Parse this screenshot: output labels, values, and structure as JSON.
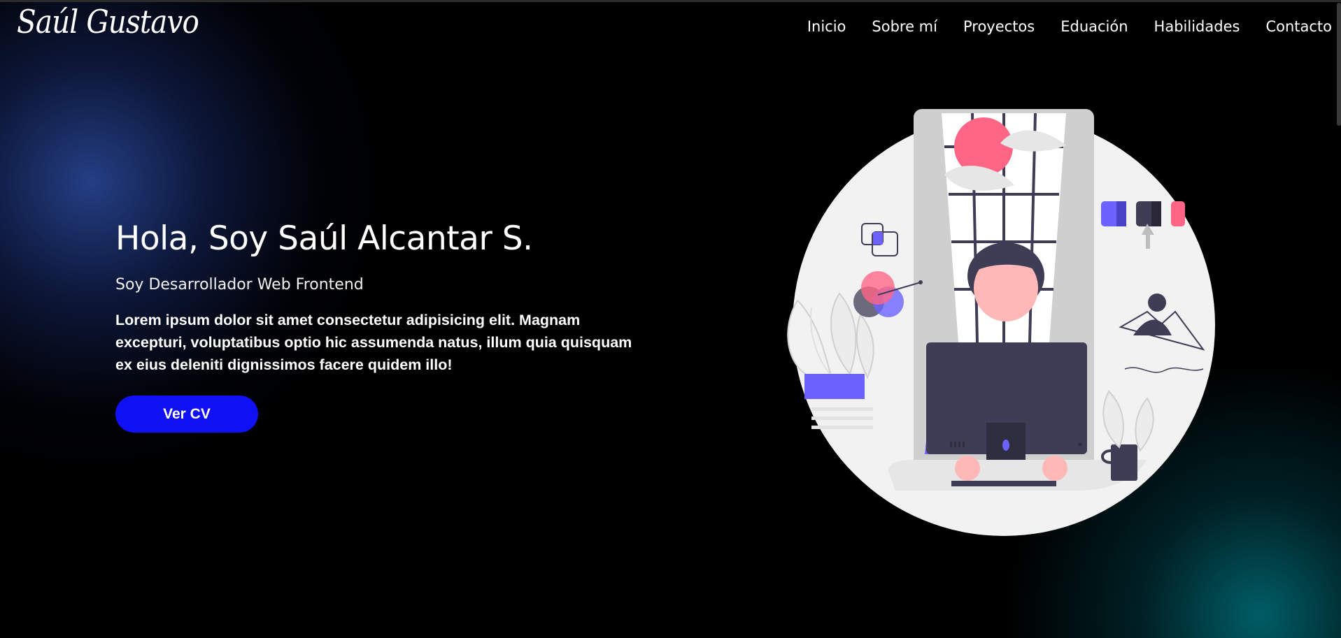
{
  "header": {
    "logo": "Saúl Gustavo",
    "nav": [
      "Inicio",
      "Sobre mí",
      "Proyectos",
      "Eduación",
      "Habilidades",
      "Contacto"
    ]
  },
  "hero": {
    "title": "Hola, Soy Saúl Alcantar S.",
    "subtitle": "Soy Desarrollador Web Frontend",
    "description": "Lorem ipsum dolor sit amet consectetur adipisicing elit. Magnam excepturi, voluptatibus optio hic assumenda natus, illum quia quisquam ex eius deleniti dignissimos facere quidem illo!",
    "cta_label": "Ver CV"
  },
  "colors": {
    "background": "#000000",
    "button": "#1010f5",
    "accent_pink": "#ff6584",
    "accent_purple": "#6c63ff",
    "dark": "#3f3d56"
  },
  "icons": [
    "developer-illustration"
  ]
}
